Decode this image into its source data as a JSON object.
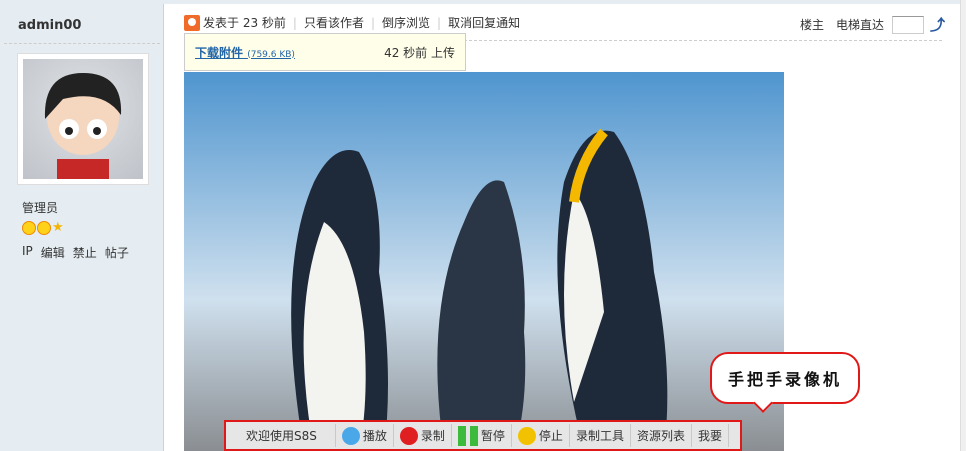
{
  "user": {
    "name": "admin00",
    "role": "管理员",
    "ops": [
      "IP",
      "编辑",
      "禁止",
      "帖子"
    ]
  },
  "post": {
    "posted": "发表于 23 秒前",
    "only_author": "只看该作者",
    "reverse": "倒序浏览",
    "cancel_notify": "取消回复通知",
    "floor": "楼主",
    "elevator": "电梯直达"
  },
  "attachment": {
    "download": "下载附件",
    "size": "(759.6 KB)",
    "uploaded": "42 秒前 上传"
  },
  "bubble": "手把手录像机",
  "toolbar": {
    "welcome": "欢迎使用S8S",
    "play": "播放",
    "record": "录制",
    "pause": "暂停",
    "stop": "停止",
    "tools": "录制工具",
    "resources": "资源列表",
    "want": "我要"
  }
}
